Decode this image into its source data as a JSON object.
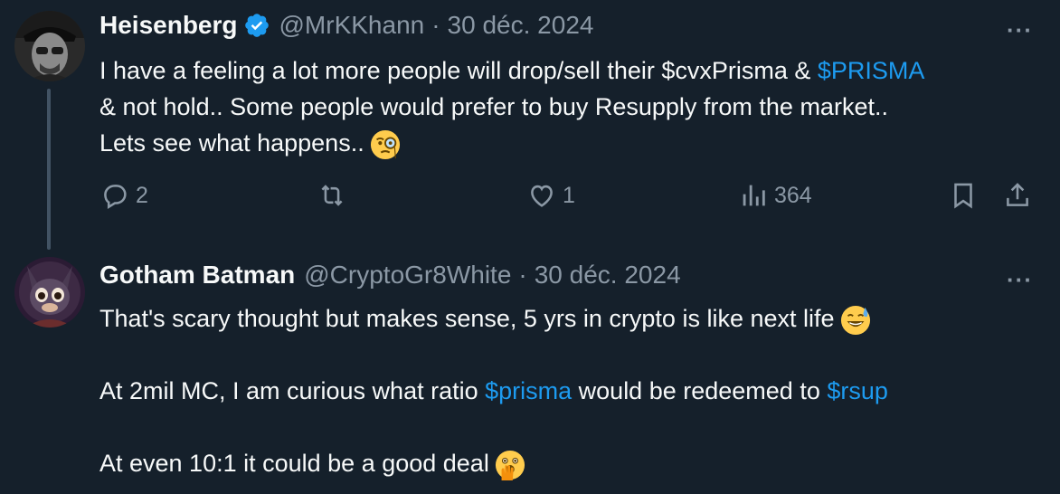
{
  "tweet1": {
    "name": "Heisenberg",
    "handle": "@MrKKhann",
    "separator": "·",
    "date": "30 déc. 2024",
    "more": "···",
    "line1_a": "I have a feeling a lot more people will drop/sell their $cvxPrisma & ",
    "line1_link": "$PRISMA",
    "line2": "& not hold.. Some people would prefer to buy Resupply from the market..",
    "line3": "Lets see what happens..",
    "emoji": "face-with-monocle",
    "actions": {
      "replies": "2",
      "likes": "1",
      "views": "364"
    }
  },
  "tweet2": {
    "name": "Gotham Batman",
    "handle": "@CryptoGr8White",
    "separator": "·",
    "date": "30 déc. 2024",
    "more": "···",
    "line1": "That's scary thought but makes sense, 5 yrs in crypto is like next life",
    "emoji1": "grinning-face-with-sweat",
    "line2_a": "At 2mil MC, I am curious what ratio ",
    "line2_link1": "$prisma",
    "line2_b": " would be redeemed to ",
    "line2_link2": "$rsup",
    "line3": "At even 10:1 it could be a good deal",
    "emoji2": "face-with-open-eyes-and-hand-over-mouth"
  },
  "colors": {
    "background": "#15202b",
    "text": "#f7f9f9",
    "secondary": "#8b98a5",
    "link": "#1d9bf0",
    "verified": "#1d9bf0"
  }
}
